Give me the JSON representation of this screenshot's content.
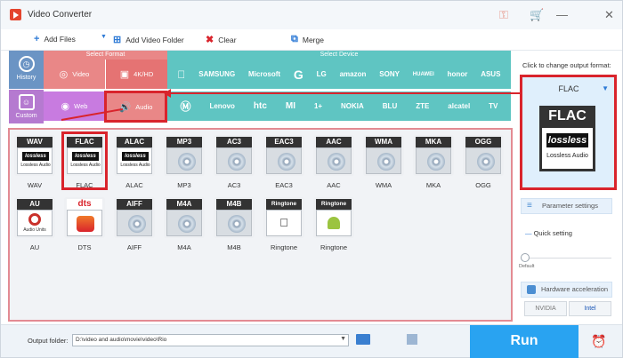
{
  "window": {
    "title": "Video Converter",
    "icons": [
      "key-icon",
      "cart-icon",
      "minimize-icon",
      "close-icon"
    ]
  },
  "toolbar": {
    "add_files": "Add Files",
    "add_video_folder": "Add Video Folder",
    "clear": "Clear",
    "merge": "Merge"
  },
  "sidebar": {
    "history": "History",
    "custom": "Custom"
  },
  "format_types": {
    "header_format": "Select Format",
    "header_device": "Select Device",
    "video": "Video",
    "hd": "4K/HD",
    "web": "Web",
    "audio": "Audio"
  },
  "devices_row1": [
    "SAMSUNG",
    "Microsoft",
    "G",
    "LG",
    "amazon",
    "SONY",
    "HUAWEI",
    "honor",
    "ASUS"
  ],
  "devices_row2": [
    "Lenovo",
    "htc",
    "MI",
    "1+",
    "NOKIA",
    "BLU",
    "ZTE",
    "alcatel",
    "TV"
  ],
  "formats_row1": [
    {
      "top": "WAV",
      "label": "WAV",
      "type": "lossless"
    },
    {
      "top": "FLAC",
      "label": "FLAC",
      "type": "lossless"
    },
    {
      "top": "ALAC",
      "label": "ALAC",
      "type": "lossless"
    },
    {
      "top": "MP3",
      "label": "MP3",
      "type": "disc"
    },
    {
      "top": "AC3",
      "label": "AC3",
      "type": "disc"
    },
    {
      "top": "EAC3",
      "label": "EAC3",
      "type": "disc"
    },
    {
      "top": "AAC",
      "label": "AAC",
      "type": "disc"
    },
    {
      "top": "WMA",
      "label": "WMA",
      "type": "disc"
    },
    {
      "top": "MKA",
      "label": "MKA",
      "type": "disc"
    },
    {
      "top": "OGG",
      "label": "OGG",
      "type": "disc"
    }
  ],
  "formats_row2": [
    {
      "top": "AU",
      "label": "AU",
      "type": "au"
    },
    {
      "top": "dts",
      "label": "DTS",
      "type": "dts"
    },
    {
      "top": "AIFF",
      "label": "AIFF",
      "type": "disc"
    },
    {
      "top": "M4A",
      "label": "M4A",
      "type": "disc"
    },
    {
      "top": "M4B",
      "label": "M4B",
      "type": "disc"
    },
    {
      "top": "Ringtone",
      "label": "Ringtone",
      "type": "apple"
    },
    {
      "top": "Ringtone",
      "label": "Ringtone",
      "type": "android"
    }
  ],
  "lossless_text": {
    "badge": "lossless",
    "sub": "Lossless Audio"
  },
  "au_sub": "Audio Units",
  "output_panel": {
    "hint": "Click to change output format:",
    "format": "FLAC",
    "icon_top": "FLAC",
    "icon_badge": "lossless",
    "icon_sub": "Lossless Audio"
  },
  "settings": {
    "parameter": "Parameter settings",
    "quick": "Quick setting",
    "default": "Default",
    "hardware": "Hardware acceleration",
    "nvidia": "NVIDIA",
    "intel": "Intel"
  },
  "bottom": {
    "output_label": "Output folder:",
    "output_path": "D:\\video and audio\\movie\\video\\Rio",
    "run": "Run"
  },
  "colors": {
    "video": "#e98787",
    "web": "#c87be0",
    "device": "#5fc5c2",
    "highlight": "#d9242c",
    "run": "#29a3f1"
  }
}
